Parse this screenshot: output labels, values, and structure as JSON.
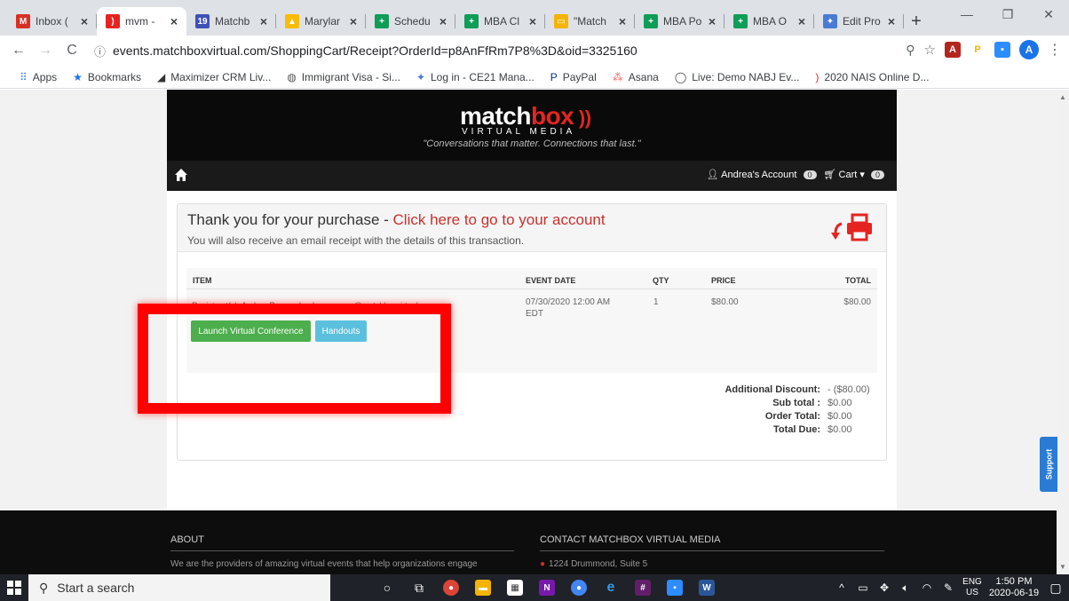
{
  "browser": {
    "tabs": [
      {
        "label": "Inbox (",
        "icon": "gmail-icon",
        "color": "#d93025",
        "glyph": "M"
      },
      {
        "label": "mvm - ",
        "icon": "rss-icon",
        "color": "#e52421",
        "glyph": ")",
        "active": true
      },
      {
        "label": "Matchb",
        "icon": "calendar-icon",
        "color": "#3f51b5",
        "glyph": "19"
      },
      {
        "label": "Marylar",
        "icon": "drive-icon",
        "color": "#fbbc04",
        "glyph": "▲"
      },
      {
        "label": "Schedu",
        "icon": "sheets-icon",
        "color": "#0f9d58",
        "glyph": "+"
      },
      {
        "label": "MBA Cl",
        "icon": "sheets-icon",
        "color": "#0f9d58",
        "glyph": "+"
      },
      {
        "label": "\"Match",
        "icon": "slides-icon",
        "color": "#f4b400",
        "glyph": "▭"
      },
      {
        "label": "MBA Po",
        "icon": "sheets-icon",
        "color": "#0f9d58",
        "glyph": "+"
      },
      {
        "label": "MBA O",
        "icon": "sheets-icon",
        "color": "#0f9d58",
        "glyph": "+"
      },
      {
        "label": "Edit Pro",
        "icon": "asana-icon",
        "color": "#4a7bd4",
        "glyph": "✦"
      }
    ],
    "url": "events.matchboxvirtual.com/ShoppingCart/Receipt?OrderId=p8AnFfRm7P8%3D&oid=3325160",
    "avatar_letter": "A",
    "bookmarks": [
      {
        "label": "Apps",
        "icon": "apps-grid-icon"
      },
      {
        "label": "Bookmarks",
        "icon": "star-icon"
      },
      {
        "label": "Maximizer CRM Liv...",
        "icon": "maximizer-icon"
      },
      {
        "label": "Immigrant Visa - Si...",
        "icon": "globe-icon"
      },
      {
        "label": "Log in - CE21 Mana...",
        "icon": "ce21-icon"
      },
      {
        "label": "PayPal",
        "icon": "paypal-icon"
      },
      {
        "label": "Asana",
        "icon": "asana-icon"
      },
      {
        "label": "Live: Demo NABJ Ev...",
        "icon": "circle-icon"
      },
      {
        "label": "2020 NAIS Online D...",
        "icon": "rss-icon"
      }
    ]
  },
  "site": {
    "logo_main": "match",
    "logo_accent": "box",
    "logo_sub": "VIRTUAL MEDIA",
    "tagline": "\"Conversations that matter. Connections that last.\"",
    "account_label": "Andrea's Account",
    "account_count": "0",
    "cart_label": "Cart",
    "cart_count": "0"
  },
  "receipt": {
    "thanks": "Thank you for your purchase - ",
    "account_link": "Click here to go to your account",
    "subtext": "You will also receive an email receipt with the details of this transaction.",
    "columns": {
      "item": "ITEM",
      "event_date": "EVENT DATE",
      "qty": "QTY",
      "price": "PRICE",
      "total": "TOTAL"
    },
    "row": {
      "event_date_line1": "07/30/2020 12:00 AM",
      "event_date_line2": "EDT",
      "qty": "1",
      "price": "$80.00",
      "total": "$80.00",
      "registrant": "Registrant(s): Andrea Powers (andrea.powers@matchboxvirtual.co"
    },
    "launch_label": "Launch Virtual Conference",
    "handouts_label": "Handouts",
    "totals": [
      {
        "label": "Additional Discount:",
        "value": "- ($80.00)"
      },
      {
        "label": "Sub total :",
        "value": "$0.00"
      },
      {
        "label": "Order Total:",
        "value": "$0.00"
      },
      {
        "label": "Total Due:",
        "value": "$0.00"
      }
    ]
  },
  "support_label": "Support",
  "footer": {
    "about_heading": "ABOUT",
    "about_text": "We are the providers of amazing virtual events that help organizations engage",
    "contact_heading": "CONTACT MATCHBOX VIRTUAL MEDIA",
    "address": "1224 Drummond, Suite 5"
  },
  "taskbar": {
    "search_placeholder": "Start a search",
    "lang_line1": "ENG",
    "lang_line2": "US",
    "time": "1:50 PM",
    "date": "2020-06-19"
  },
  "colors": {
    "accent_red": "#c9302c",
    "green_button": "#4cae4c",
    "blue_button": "#5bc0de",
    "highlight_box": "#ff0000"
  }
}
